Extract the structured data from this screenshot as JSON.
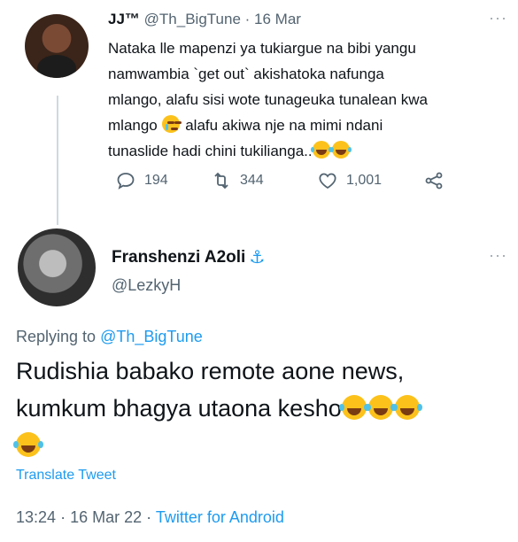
{
  "parent_tweet": {
    "name": "JJ™",
    "handle": "@Th_BigTune",
    "separator": "·",
    "date": "16 Mar",
    "text_lines": [
      "Nataka lle mapenzi  ya tukiargue na bibi yangu",
      "namwambia `get out` akishatoka nafunga",
      "mlango, alafu sisi wote tunageuka tunalean kwa",
      "mlango",
      " alafu akiwa nje na mimi ndani",
      "tunaslide hadi chini tukilianga.."
    ],
    "stats": {
      "replies": "194",
      "retweets": "344",
      "likes": "1,001"
    },
    "icons": [
      "reply-icon",
      "retweet-icon",
      "like-icon",
      "share-icon"
    ]
  },
  "reply_tweet": {
    "name": "Franshenzi A2oli",
    "name_badge": "⚓",
    "handle": "@LezkyH",
    "replying_prefix": "Replying to",
    "replying_handle": "@Th_BigTune",
    "text_line1": "Rudishia babako remote aone news,",
    "text_line2": "kumkum bhagya utaona kesho",
    "translate_label": "Translate Tweet",
    "time": "13:24",
    "date": "16 Mar 22",
    "separator": "·",
    "source": "Twitter for Android"
  },
  "colors": {
    "accent": "#1d9bf0",
    "secondary": "#536471",
    "text": "#0f1419",
    "line": "#cfd9de"
  }
}
